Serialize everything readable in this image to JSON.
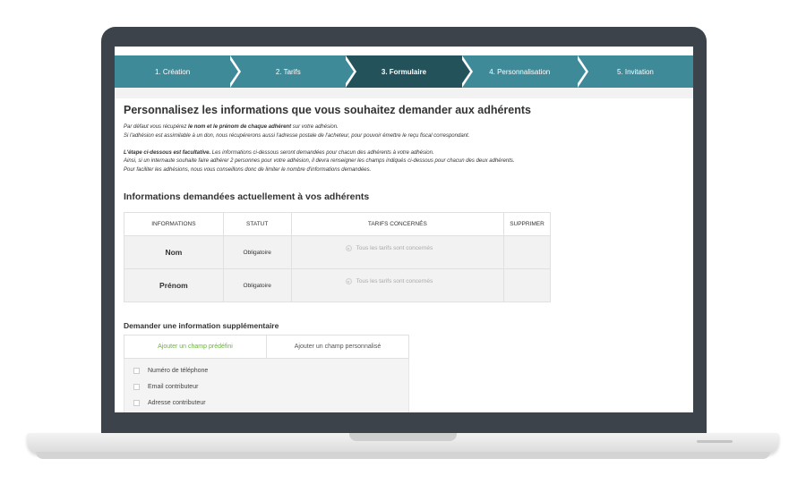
{
  "stepper": {
    "steps": [
      {
        "label": "1. Création"
      },
      {
        "label": "2. Tarifs"
      },
      {
        "label": "3. Formulaire"
      },
      {
        "label": "4. Personnalisation"
      },
      {
        "label": "5. Invitation"
      }
    ],
    "active_index": 2
  },
  "main": {
    "title": "Personnalisez les informations que vous souhaitez demander aux adhérents",
    "intro": {
      "line1_prefix": "Par défaut vous récupérez ",
      "line1_bold": "le nom et le prénom de chaque adhérent",
      "line1_suffix": " sur votre adhésion.",
      "line2": "Si l'adhésion est assimilable à un don, nous récupérerons aussi l'adresse postale de l'acheteur, pour pouvoir émettre le reçu fiscal correspondant.",
      "line3_bold": "L'étape ci-dessous est facultative.",
      "line3_suffix": " Les informations ci-dessous seront demandées pour chacun des adhérents à votre adhésion.",
      "line4": "Ainsi, si un internaute souhaite faire adhérer 2 personnes pour votre adhésion, il devra renseigner les champs indiqués ci-dessous pour chacun des deux adhérents.",
      "line5": "Pour faciliter les adhésions, nous vous conseillons donc de limiter le nombre d'informations demandées."
    },
    "section_title": "Informations demandées actuellement à vos adhérents",
    "table": {
      "headers": [
        "INFORMATIONS",
        "STATUT",
        "TARIFS CONCERNÉS",
        "SUPPRIMER"
      ],
      "rows": [
        {
          "info": "Nom",
          "statut": "Obligatoire",
          "tarifs": "Tous les tarifs sont concernés"
        },
        {
          "info": "Prénom",
          "statut": "Obligatoire",
          "tarifs": "Tous les tarifs sont concernés"
        }
      ]
    },
    "extra": {
      "title": "Demander une information supplémentaire",
      "tabs": [
        "Ajouter un champ prédéfini",
        "Ajouter un champ personnalisé"
      ],
      "options": [
        "Numéro de téléphone",
        "Email contributeur",
        "Adresse contributeur"
      ]
    }
  },
  "colors": {
    "stepper": "#3e8a99",
    "stepper_active": "#24525b",
    "accent_green": "#6bb33e",
    "laptop_bezel": "#3c434b"
  }
}
